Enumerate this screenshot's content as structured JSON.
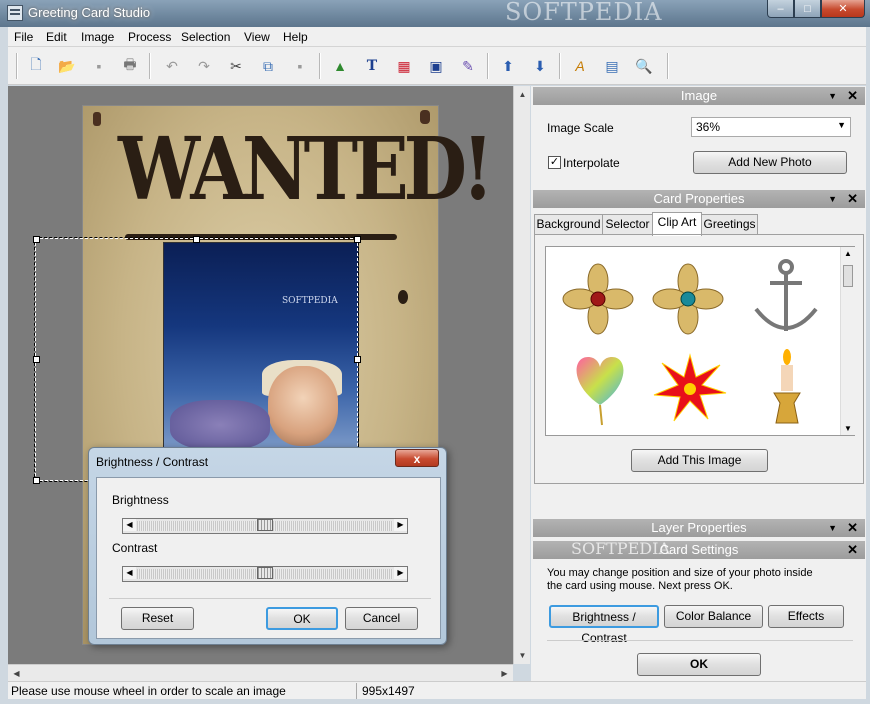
{
  "window": {
    "title": "Greeting Card Studio",
    "watermark": "SOFTPEDIA",
    "min_label": "–",
    "max_label": "□",
    "close_label": "✕"
  },
  "menu": [
    "File",
    "Edit",
    "Image",
    "Process",
    "Selection",
    "View",
    "Help"
  ],
  "toolbar": {
    "icons": [
      "new-icon",
      "open-icon",
      "save-icon",
      "print-icon",
      "undo-icon",
      "redo-icon",
      "cut-icon",
      "copy-icon",
      "paste-icon",
      "image-icon",
      "text-icon",
      "clipart-icon",
      "frame-icon",
      "effects-icon",
      "move-up-icon",
      "move-down-icon",
      "font-icon",
      "page-icon",
      "preview-icon"
    ],
    "glyphs": [
      "🗋",
      "📂",
      "▪",
      "🖶",
      "↶",
      "↷",
      "✂",
      "⧉",
      "▪",
      "▲",
      "T",
      "▦",
      "▣",
      "✎",
      "⬆",
      "⬇",
      "A",
      "▤",
      "🔍"
    ]
  },
  "poster": {
    "heading": "WANTED!",
    "photo_watermark": "SOFTPEDIA"
  },
  "status": {
    "message": "Please use mouse wheel in order to scale an image",
    "size": "995x1497"
  },
  "image_panel": {
    "title": "Image",
    "scale_label": "Image Scale",
    "scale_value": "36%",
    "interpolate_label": "Interpolate",
    "interpolate_checked": true,
    "add_photo_label": "Add New Photo"
  },
  "card_properties": {
    "title": "Card Properties",
    "tabs": [
      "Background",
      "Selector",
      "Clip Art",
      "Greetings"
    ],
    "active_tab": "Clip Art",
    "clipart": [
      "ornament-red-icon",
      "ornament-teal-icon",
      "anchor-icon",
      "heart-balloon-icon",
      "starburst-icon",
      "candle-icon"
    ],
    "add_image_label": "Add This Image"
  },
  "layer_properties": {
    "title": "Layer Properties"
  },
  "card_settings": {
    "title": "Card Settings",
    "watermark": "SOFTPEDIA",
    "hint_line1": "You may change position and size of your photo inside",
    "hint_line2": "the card using mouse. Next press OK.",
    "buttons": [
      "Brightness / Contrast",
      "Color Balance",
      "Effects"
    ],
    "ok_label": "OK"
  },
  "dialog": {
    "title": "Brightness / Contrast",
    "close_label": "x",
    "brightness_label": "Brightness",
    "brightness_value": 0.5,
    "contrast_label": "Contrast",
    "contrast_value": 0.5,
    "reset_label": "Reset",
    "ok_label": "OK",
    "cancel_label": "Cancel"
  }
}
